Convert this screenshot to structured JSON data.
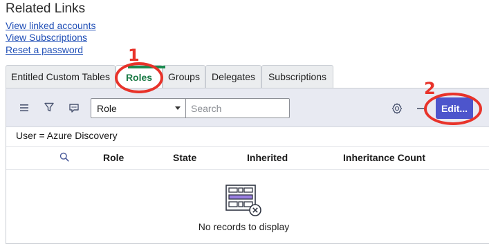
{
  "related": {
    "title": "Related Links",
    "links": [
      "View linked accounts",
      "View Subscriptions",
      "Reset a password"
    ]
  },
  "tabs": [
    {
      "label": "Entitled Custom Tables",
      "active": false
    },
    {
      "label": "Roles",
      "active": true
    },
    {
      "label": "Groups",
      "active": false
    },
    {
      "label": "Delegates",
      "active": false
    },
    {
      "label": "Subscriptions",
      "active": false
    }
  ],
  "toolbar": {
    "icons": [
      "menu-icon",
      "filter-icon",
      "comment-icon"
    ],
    "field_select": "Role",
    "search_placeholder": "Search",
    "settings_icon": "gear-icon",
    "edit_label": "Edit..."
  },
  "filter": "User = Azure Discovery",
  "table": {
    "search_icon": "search-icon",
    "columns": [
      "Role",
      "State",
      "Inherited",
      "Inheritance Count"
    ]
  },
  "empty_state": {
    "icon": "empty-records-icon",
    "text": "No records to display"
  },
  "annotations": {
    "first": "1",
    "second": "2",
    "color": "#e8332a"
  },
  "colors": {
    "accent_green": "#1a8a4f",
    "edit_button": "#4d55cc",
    "toolbar_bg": "#e8eaf2",
    "link": "#1f4eb6"
  }
}
